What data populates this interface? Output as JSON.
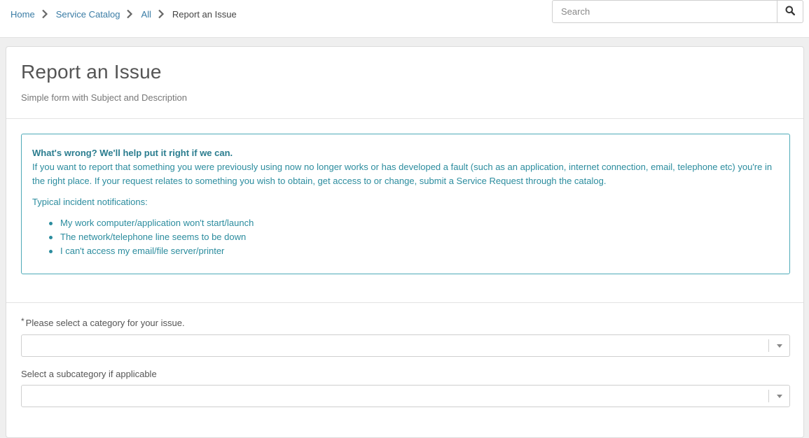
{
  "breadcrumb": {
    "items": [
      "Home",
      "Service Catalog",
      "All"
    ],
    "current": "Report an Issue"
  },
  "search": {
    "placeholder": "Search",
    "value": ""
  },
  "header": {
    "title": "Report an Issue",
    "subtitle": "Simple form with Subject and Description"
  },
  "info": {
    "heading": "What's wrong? We'll help put it right if we can.",
    "paragraph": "If you want to report that something you were previously using now no longer works or has developed a fault (such as an application, internet connection, email, telephone etc) you're in the right place. If your request relates to something you wish to obtain, get access to or change, submit a Service Request through the catalog.",
    "list_label": "Typical incident notifications:",
    "list": [
      "My work computer/application won't start/launch",
      "The network/telephone line seems to be down",
      "I can't access my email/file server/printer"
    ]
  },
  "form": {
    "category": {
      "required_mark": "*",
      "label": "Please select a category for your issue.",
      "value": ""
    },
    "subcategory": {
      "label": "Select a subcategory if applicable",
      "value": ""
    }
  },
  "colors": {
    "link": "#3a7ca5",
    "info_border": "#4eaab8",
    "info_text": "#2b8c9e"
  },
  "icons": {
    "breadcrumb_separator": "chevron-right-icon",
    "search": "search-icon",
    "select_arrow": "caret-down-icon"
  }
}
